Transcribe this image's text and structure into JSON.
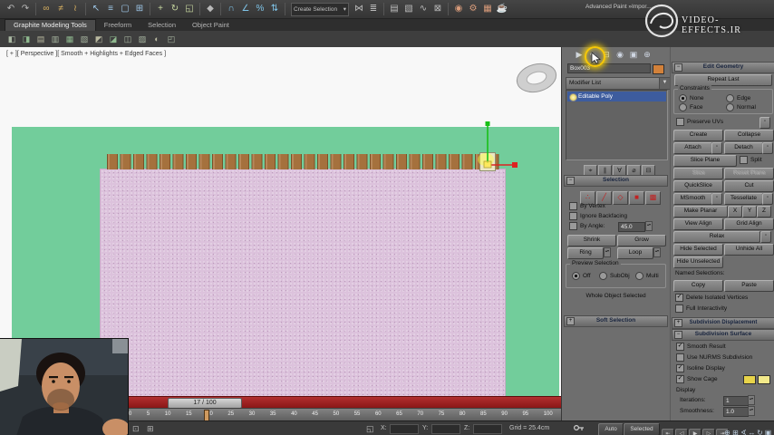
{
  "header": {
    "advanced_paint": "Advanced Paint »Impor...",
    "watermark": "VIDEO-EFFECTS.IR",
    "create_selection_combo": "Create Selection"
  },
  "toolbar": {
    "icons": {
      "undo": "↶",
      "redo": "↷",
      "select_link": "∞",
      "unlink": "≠",
      "bind_spacewarp": "≀",
      "select_object": "↖",
      "select_by_name": "≡",
      "rect_region": "▢",
      "window_crossing": "⊞",
      "move": "+",
      "rotate": "↻",
      "scale": "◱",
      "manipulate": "◆",
      "snap_3d": "∩",
      "angle_snap": "∠",
      "percent_snap": "%",
      "spinner_snap": "⇅",
      "mirror": "⋈",
      "align": "≣",
      "layer_manager": "▤",
      "graphite": "▧",
      "curve_editor": "∿",
      "schematic_view": "⊠",
      "material_editor": "◉",
      "render_setup": "⚙",
      "rendered_frame": "▦",
      "render": "☕"
    }
  },
  "ribbon": {
    "tabs": [
      "Graphite Modeling Tools",
      "Freeform",
      "Selection",
      "Object Paint"
    ],
    "icons": [
      "◧",
      "◨",
      "▤",
      "▥",
      "▦",
      "▧",
      "◩",
      "◪",
      "◫",
      "▨",
      "◐",
      "◰"
    ]
  },
  "viewport": {
    "label": "[ + ][ Perspective ][ Smooth + Highlights + Edged Faces ]"
  },
  "timeline": {
    "slider": "17 / 100",
    "ticks": [
      "0",
      "5",
      "10",
      "15",
      "20",
      "25",
      "30",
      "35",
      "40",
      "45",
      "50",
      "55",
      "60",
      "65",
      "70",
      "75",
      "80",
      "85",
      "90",
      "95",
      "100"
    ]
  },
  "status": {
    "x_label": "X:",
    "y_label": "Y:",
    "z_label": "Z:",
    "x_value": "",
    "y_value": "",
    "z_value": "",
    "grid": "Grid = 25.4cm",
    "auto": "Auto",
    "selected": "Selected"
  },
  "panel": {
    "object_name": "Box003",
    "modifier_list": "Modifier List",
    "stack_item": "Editable Poly",
    "selection": {
      "title": "Selection",
      "by_vertex": "By Vertex",
      "ignore_backfacing": "Ignore Backfacing",
      "by_angle": "By Angle:",
      "angle_value": "45.0",
      "shrink": "Shrink",
      "grow": "Grow",
      "ring": "Ring",
      "loop": "Loop",
      "preview": "Preview Selection",
      "off": "Off",
      "subobj": "SubObj",
      "multi": "Multi",
      "status": "Whole Object Selected"
    },
    "soft_selection": "Soft Selection",
    "edit_geometry": {
      "title": "Edit Geometry",
      "repeat_last": "Repeat Last",
      "constraints": "Constraints",
      "none": "None",
      "edge": "Edge",
      "face": "Face",
      "normal": "Normal",
      "preserve_uvs": "Preserve UVs",
      "create": "Create",
      "collapse": "Collapse",
      "attach": "Attach",
      "detach": "Detach",
      "slice_plane": "Slice Plane",
      "split": "Split",
      "slice": "Slice",
      "reset_plane": "Reset Plane",
      "quickslice": "QuickSlice",
      "cut": "Cut",
      "msmooth": "MSmooth",
      "tessellate": "Tessellate",
      "make_planar": "Make Planar",
      "x": "X",
      "y": "Y",
      "z": "Z",
      "view_align": "View Align",
      "grid_align": "Grid Align",
      "relax": "Relax",
      "hide_selected": "Hide Selected",
      "unhide_all": "Unhide All",
      "hide_unselected": "Hide Unselected",
      "named_selections": "Named Selections:",
      "copy": "Copy",
      "paste": "Paste",
      "delete_isolated": "Delete Isolated Vertices",
      "full_interactivity": "Full Interactivity"
    },
    "subdivision_displacement": "Subdivision Displacement",
    "subdivision_surface": {
      "title": "Subdivision Surface",
      "smooth_result": "Smooth Result",
      "use_nurms": "Use NURMS Subdivision",
      "isoline": "Isoline Display",
      "show_cage": "Show Cage",
      "display": "Display",
      "iterations": "Iterations:",
      "iterations_value": "1",
      "smoothness": "Smoothness:",
      "smoothness_value": "1.0"
    }
  }
}
